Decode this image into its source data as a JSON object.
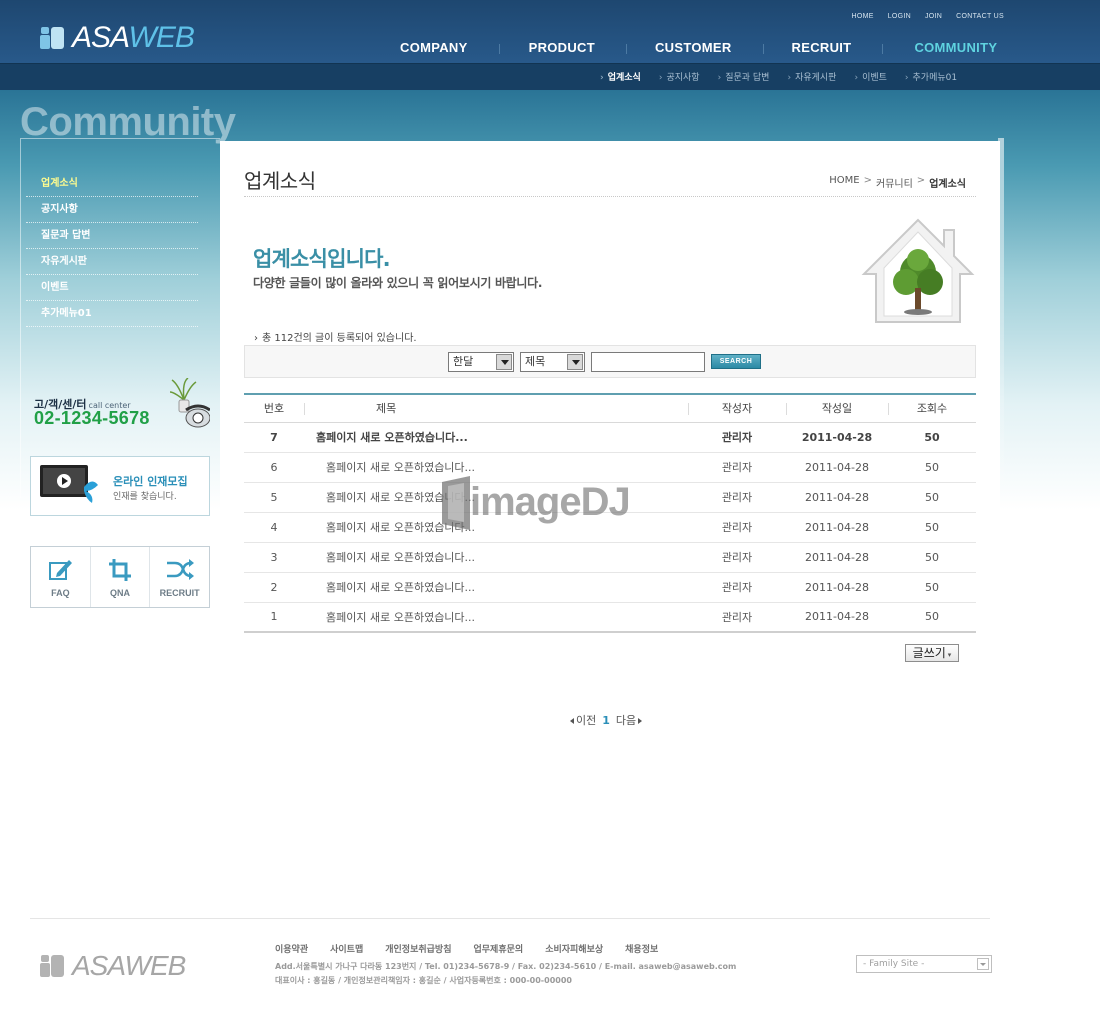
{
  "logo": {
    "part1": "ASA",
    "part2": "WEB"
  },
  "util_links": [
    "HOME",
    "LOGIN",
    "JOIN",
    "CONTACT US"
  ],
  "gnb": [
    "COMPANY",
    "PRODUCT",
    "CUSTOMER",
    "RECRUIT",
    "COMMUNITY"
  ],
  "lnb": [
    "업계소식",
    "공지사항",
    "질문과 답변",
    "자유게시판",
    "이벤트",
    "추가메뉴01"
  ],
  "section_title": "Community",
  "side_menu": [
    "업계소식",
    "공지사항",
    "질문과 답변",
    "자유게시판",
    "이벤트",
    "추가메뉴01"
  ],
  "call_center": {
    "label": "고/객/센/터",
    "sub": "call center",
    "number": "02-1234-5678"
  },
  "recruit_banner": {
    "title": "온라인 인재모집",
    "sub": "인재를 찾습니다."
  },
  "quick_links": [
    "FAQ",
    "QNA",
    "RECRUIT"
  ],
  "page": {
    "title": "업계소식",
    "breadcrumb": [
      "HOME",
      "커뮤니티",
      "업계소식"
    ],
    "intro_title": "업계소식입니다.",
    "intro_sub": "다양한 글들이 많이 올라와 있으니 꼭 읽어보시기 바랍니다.",
    "total_text": "총 112건의 글이 등록되어 있습니다."
  },
  "search": {
    "period": "한달",
    "field": "제목",
    "query": "",
    "button": "SEARCH"
  },
  "board": {
    "headers": [
      "번호",
      "제목",
      "작성자",
      "작성일",
      "조회수"
    ],
    "rows": [
      {
        "no": "7",
        "title": "홈페이지 새로 오픈하였습니다...",
        "author": "관리자",
        "date": "2011-04-28",
        "views": "50"
      },
      {
        "no": "6",
        "title": "홈페이지 새로 오픈하였습니다...",
        "author": "관리자",
        "date": "2011-04-28",
        "views": "50"
      },
      {
        "no": "5",
        "title": "홈페이지 새로 오픈하였습니다...",
        "author": "관리자",
        "date": "2011-04-28",
        "views": "50"
      },
      {
        "no": "4",
        "title": "홈페이지 새로 오픈하였습니다...",
        "author": "관리자",
        "date": "2011-04-28",
        "views": "50"
      },
      {
        "no": "3",
        "title": "홈페이지 새로 오픈하였습니다...",
        "author": "관리자",
        "date": "2011-04-28",
        "views": "50"
      },
      {
        "no": "2",
        "title": "홈페이지 새로 오픈하였습니다...",
        "author": "관리자",
        "date": "2011-04-28",
        "views": "50"
      },
      {
        "no": "1",
        "title": "홈페이지 새로 오픈하였습니다...",
        "author": "관리자",
        "date": "2011-04-28",
        "views": "50"
      }
    ]
  },
  "write_button": "글쓰기",
  "paging": {
    "prev": "이전",
    "current": "1",
    "next": "다음"
  },
  "watermark": "imageDJ",
  "footer": {
    "links": [
      "이용약관",
      "사이트맵",
      "개인정보취급방침",
      "업무제휴문의",
      "소비자피해보상",
      "채용정보"
    ],
    "address": "Add.서울특별시 가나구 다라동 123번지  / Tel. 01)234-5678-9  / Fax. 02)234-5610  / E-mail. asaweb@asaweb.com",
    "ceo": "대표이사 : 홍길동 / 개인정보관리책임자 : 홍길순 / 사업자등록번호 : 000-00-00000",
    "family_site": "- Family Site -"
  },
  "colors": {
    "accent": "#3a8fa6",
    "nav_active": "#5fd3e0",
    "side_active": "#fffc8f",
    "call_number": "#21a047"
  }
}
